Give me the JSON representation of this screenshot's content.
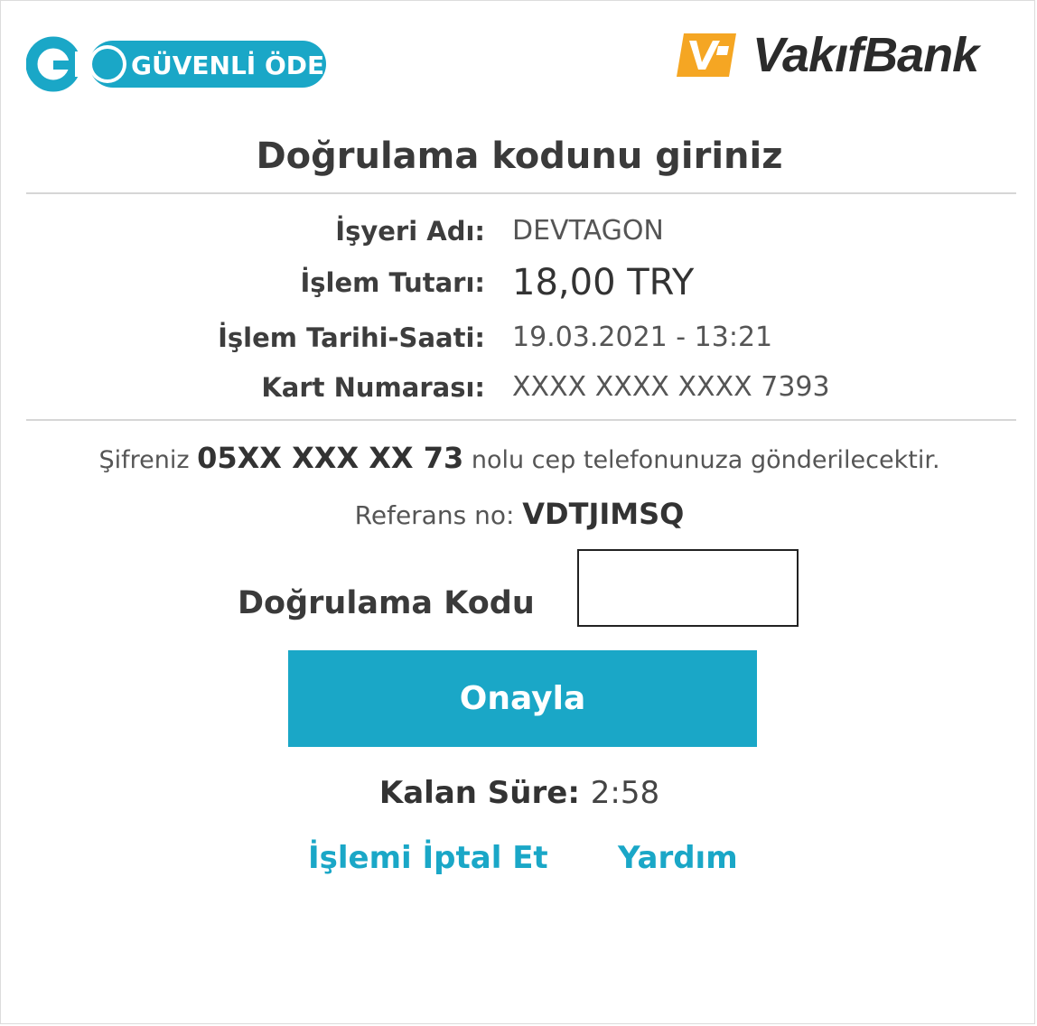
{
  "header": {
    "go_logo": {
      "text": "GO",
      "label": "GÜVENLİ ÖDE"
    },
    "bank_logo": {
      "text": "VakıfBank"
    }
  },
  "title": "Doğrulama kodunu giriniz",
  "details": [
    {
      "label": "İşyeri Adı:",
      "value": "DEVTAGON"
    },
    {
      "label": "İşlem Tutarı:",
      "value": "18,00 TRY"
    },
    {
      "label": "İşlem Tarihi-Saati:",
      "value": "19.03.2021 - 13:21"
    },
    {
      "label": "Kart Numarası:",
      "value": "XXXX XXXX XXXX 7393"
    }
  ],
  "notice": {
    "prefix": "Şifreniz ",
    "phone": "05XX XXX XX 73",
    "suffix": " nolu cep telefonunuza gönderilecektir."
  },
  "reference": {
    "label": "Referans no: ",
    "value": "VDTJIMSQ"
  },
  "code": {
    "label": "Doğrulama Kodu",
    "value": "",
    "placeholder": ""
  },
  "confirm_button": "Onayla",
  "timer": {
    "label": "Kalan Süre: ",
    "value": "2:58"
  },
  "links": {
    "cancel": "İşlemi İptal Et",
    "help": "Yardım"
  },
  "colors": {
    "accent": "#1aa7c7",
    "brand_orange": "#f5a623",
    "text_dark": "#333333"
  }
}
